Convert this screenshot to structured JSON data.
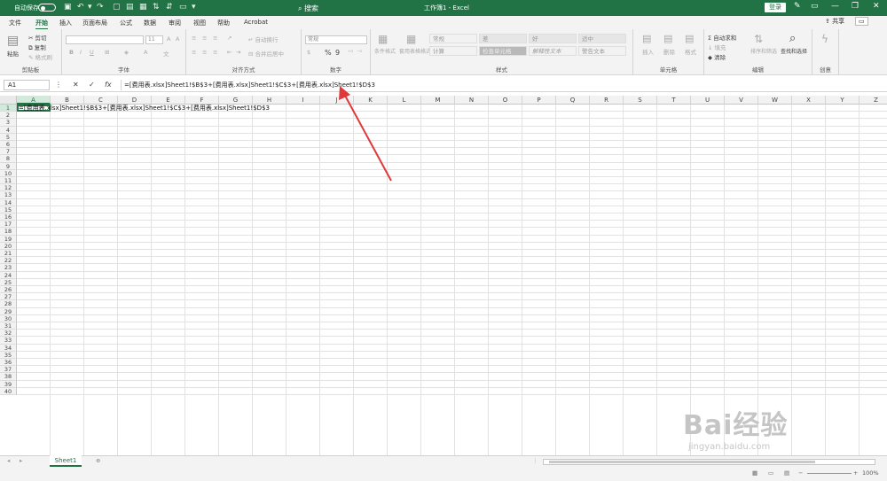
{
  "titlebar": {
    "autosave_label": "自动保存",
    "autosave_state": "关",
    "window_title": "工作簿1 - Excel",
    "sign_in": "登录",
    "search": "搜索"
  },
  "tabs": [
    "文件",
    "开始",
    "插入",
    "页面布局",
    "公式",
    "数据",
    "审阅",
    "视图",
    "帮助",
    "Acrobat"
  ],
  "active_tab": "开始",
  "share_label": "共享",
  "comment_label": "",
  "ribbon": {
    "clipboard": {
      "paste": "粘贴",
      "cut": "剪切",
      "copy": "复制",
      "format_painter": "格式刷",
      "label": "剪贴板"
    },
    "font": {
      "size": "11",
      "bold": "B",
      "italic": "I",
      "underline": "U",
      "label": "字体"
    },
    "alignment": {
      "wrap": "自动换行",
      "merge": "合并后居中",
      "label": "对齐方式"
    },
    "number": {
      "format": "常规",
      "percent": "%",
      "comma": "9",
      "label": "数字"
    },
    "styles": {
      "conditional": "条件格式",
      "table": "套用表格格式",
      "cells_styles": [
        "常规",
        "差",
        "好",
        "适中",
        "计算",
        "检查单元格",
        "解释性文本",
        "警告文本"
      ],
      "label": "样式"
    },
    "cells": {
      "insert": "插入",
      "delete": "删除",
      "format": "格式",
      "label": "单元格"
    },
    "editing": {
      "autosum": "自动求和",
      "fill": "填充",
      "clear": "清除",
      "sort": "排序和筛选",
      "find": "查找和选择",
      "label": "编辑"
    },
    "create": {
      "label": "创意"
    }
  },
  "formula_bar": {
    "name_box": "A1",
    "fx": "fx",
    "formula": "=[费用表.xlsx]Sheet1!$B$3+[费用表.xlsx]Sheet1!$C$3+[费用表.xlsx]Sheet1!$D$3"
  },
  "columns": [
    "A",
    "B",
    "C",
    "D",
    "E",
    "F",
    "G",
    "H",
    "I",
    "J",
    "K",
    "L",
    "M",
    "N",
    "O",
    "P",
    "Q",
    "R",
    "S",
    "T",
    "U",
    "V",
    "W",
    "X",
    "Y",
    "Z"
  ],
  "rows": [
    "1",
    "2",
    "3",
    "4",
    "5",
    "6",
    "7",
    "8",
    "9",
    "10",
    "11",
    "12",
    "13",
    "14",
    "15",
    "16",
    "17",
    "18",
    "19",
    "20",
    "21",
    "22",
    "23",
    "24",
    "25",
    "26",
    "27",
    "28",
    "29",
    "30",
    "31",
    "32",
    "33",
    "34",
    "35",
    "36",
    "37",
    "38",
    "39",
    "40"
  ],
  "cell_a1": "=[费用表.xlsx]Sheet1!$B$3+[费用表.xlsx]Sheet1!$C$3+[费用表.xlsx]Sheet1!$D$3",
  "sheet_tab": "Sheet1",
  "zoom": "100%",
  "watermark": {
    "brand": "Bai经验",
    "url": "jingyan.baidu.com"
  },
  "colors": {
    "accent": "#217346",
    "arrow": "#e0393c"
  }
}
